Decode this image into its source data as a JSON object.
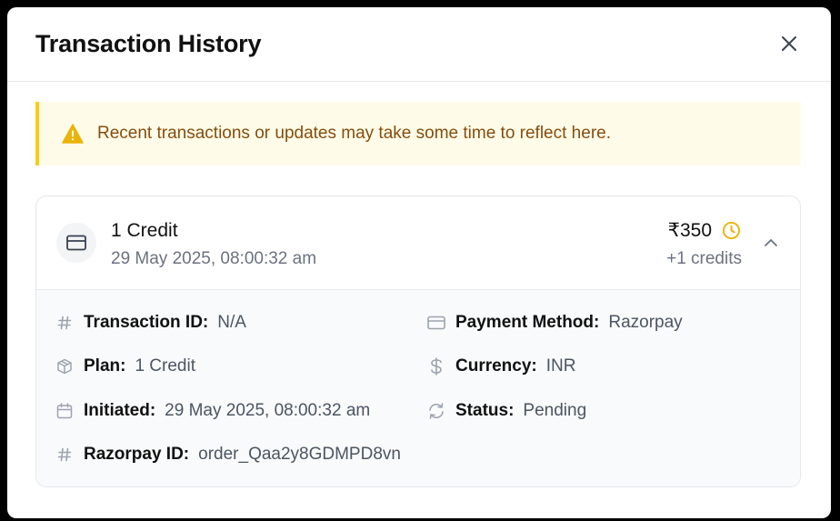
{
  "modal": {
    "title": "Transaction History",
    "close_icon": "close-icon"
  },
  "alert": {
    "icon": "warning-icon",
    "text": "Recent transactions or updates may take some time to reflect here.",
    "colors": {
      "background": "#fefce8",
      "border": "#facc15",
      "text": "#854d0e"
    }
  },
  "transaction": {
    "icon": "credit-card-icon",
    "title": "1 Credit",
    "date": "29 May 2025, 08:00:32 am",
    "amount": "₹350",
    "status_icon": "clock-icon",
    "credits": "+1 credits",
    "expand_icon": "chevron-up-icon",
    "details": {
      "transaction_id": {
        "label": "Transaction ID:",
        "value": "N/A",
        "icon": "hash-icon"
      },
      "payment_method": {
        "label": "Payment Method:",
        "value": "Razorpay",
        "icon": "credit-card-icon"
      },
      "plan": {
        "label": "Plan:",
        "value": "1 Credit",
        "icon": "package-icon"
      },
      "currency": {
        "label": "Currency:",
        "value": "INR",
        "icon": "dollar-icon"
      },
      "initiated": {
        "label": "Initiated:",
        "value": "29 May 2025, 08:00:32 am",
        "icon": "calendar-icon"
      },
      "status": {
        "label": "Status:",
        "value": "Pending",
        "icon": "refresh-icon"
      },
      "razorpay_id": {
        "label": "Razorpay ID:",
        "value": "order_Qaa2y8GDMPD8vn",
        "icon": "hash-icon"
      }
    }
  }
}
